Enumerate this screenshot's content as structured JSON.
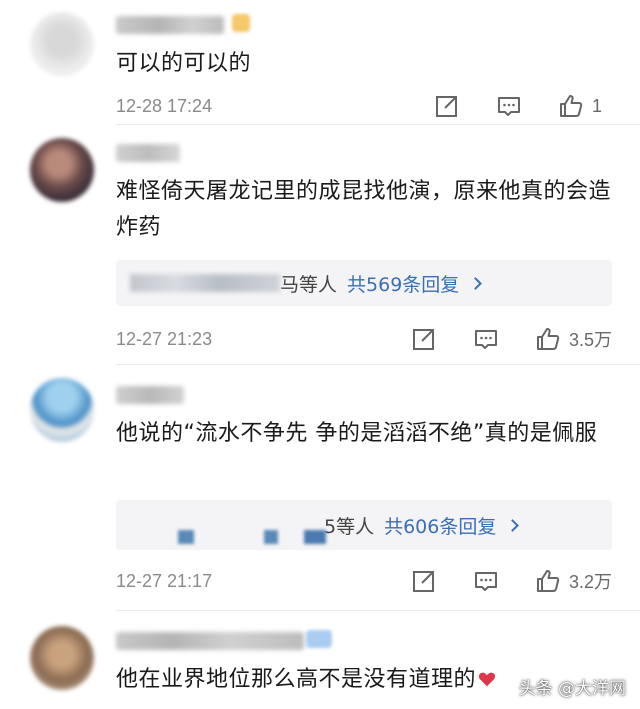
{
  "colors": {
    "accent_link": "#3a6fb5",
    "meta_gray": "#8a8a8a",
    "reply_bg": "#f4f4f6",
    "heart_red": "#e0364a"
  },
  "comments": [
    {
      "text": "可以的可以的",
      "time": "12-28 17:24",
      "like_count": "1"
    },
    {
      "text": "难怪倚天屠龙记里的成昆找他演，原来他真的会造炸药",
      "reply_names_suffix": "马等人",
      "reply_more": "共569条回复",
      "time": "12-27 21:23",
      "like_count": "3.5万"
    },
    {
      "text": "他说的“流水不争先 争的是滔滔不绝”真的是佩服",
      "reply_names_suffix": "5等人",
      "reply_more": "共606条回复",
      "time": "12-27 21:17",
      "like_count": "3.2万"
    },
    {
      "text": "他在业界地位那么高不是没有道理的"
    }
  ],
  "icons": {
    "share": "share-icon",
    "comment": "comment-icon",
    "like": "thumbs-up-icon",
    "heart": "heart-icon"
  },
  "watermark": "头条 @大洋网"
}
